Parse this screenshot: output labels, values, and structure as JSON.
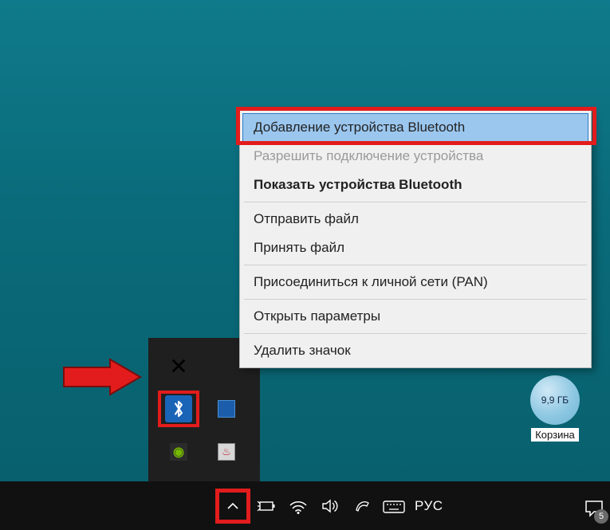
{
  "recycle_bin": {
    "label": "Корзина",
    "size": "9,9 ГБ"
  },
  "context_menu": {
    "items": [
      {
        "label": "Добавление устройства Bluetooth",
        "highlight": true
      },
      {
        "label": "Разрешить подключение устройства",
        "disabled": true
      },
      {
        "label": "Показать устройства Bluetooth",
        "bold": true
      },
      {
        "sep": true
      },
      {
        "label": "Отправить файл"
      },
      {
        "label": "Принять файл"
      },
      {
        "sep": true
      },
      {
        "label": "Присоединиться к личной сети (PAN)"
      },
      {
        "sep": true
      },
      {
        "label": "Открыть параметры"
      },
      {
        "sep": true
      },
      {
        "label": "Удалить значок"
      }
    ]
  },
  "tray_popup": {
    "icons": [
      "app-x",
      "empty",
      "bluetooth",
      "intel",
      "nvidia",
      "java",
      "circle"
    ]
  },
  "taskbar": {
    "lang": "РУС",
    "notification_count": "5"
  }
}
